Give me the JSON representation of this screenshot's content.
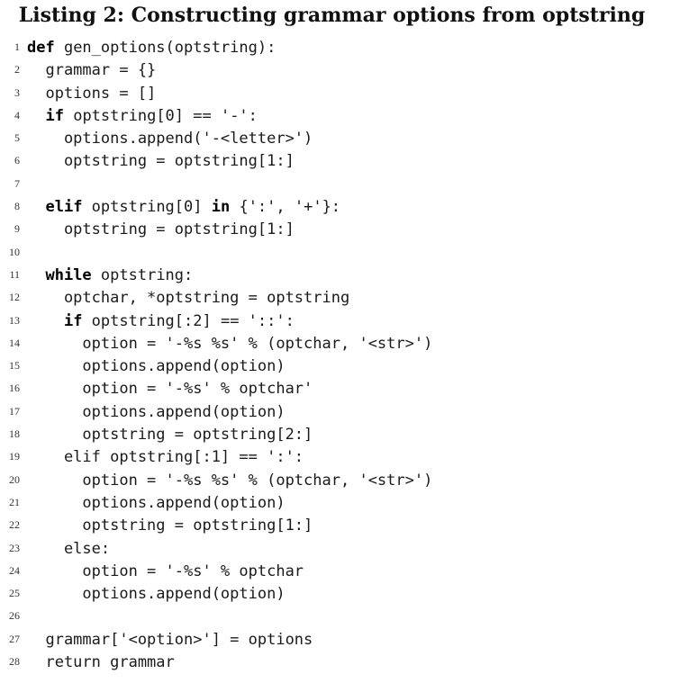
{
  "caption": "Listing 2: Constructing grammar options from optstring",
  "lines": [
    {
      "n": "1",
      "parts": [
        {
          "t": "def",
          "kw": true
        },
        {
          "t": " gen_options(optstring):"
        }
      ]
    },
    {
      "n": "2",
      "parts": [
        {
          "t": "  grammar = {}"
        }
      ]
    },
    {
      "n": "3",
      "parts": [
        {
          "t": "  options = []"
        }
      ]
    },
    {
      "n": "4",
      "parts": [
        {
          "t": "  "
        },
        {
          "t": "if",
          "kw": true
        },
        {
          "t": " optstring[0] == '-':"
        }
      ]
    },
    {
      "n": "5",
      "parts": [
        {
          "t": "    options.append('-<letter>')"
        }
      ]
    },
    {
      "n": "6",
      "parts": [
        {
          "t": "    optstring = optstring[1:]"
        }
      ]
    },
    {
      "n": "7",
      "parts": [
        {
          "t": ""
        }
      ]
    },
    {
      "n": "8",
      "parts": [
        {
          "t": "  "
        },
        {
          "t": "elif",
          "kw": true
        },
        {
          "t": " optstring[0] "
        },
        {
          "t": "in",
          "kw": true
        },
        {
          "t": " {':', '+'}:"
        }
      ]
    },
    {
      "n": "9",
      "parts": [
        {
          "t": "    optstring = optstring[1:]"
        }
      ]
    },
    {
      "n": "10",
      "parts": [
        {
          "t": ""
        }
      ]
    },
    {
      "n": "11",
      "parts": [
        {
          "t": "  "
        },
        {
          "t": "while",
          "kw": true
        },
        {
          "t": " optstring:"
        }
      ]
    },
    {
      "n": "12",
      "parts": [
        {
          "t": "    optchar, *optstring = optstring"
        }
      ]
    },
    {
      "n": "13",
      "parts": [
        {
          "t": "    "
        },
        {
          "t": "if",
          "kw": true
        },
        {
          "t": " optstring[:2] == '::':"
        }
      ]
    },
    {
      "n": "14",
      "parts": [
        {
          "t": "      option = '-%s %s' % (optchar, '<str>')"
        }
      ]
    },
    {
      "n": "15",
      "parts": [
        {
          "t": "      options.append(option)"
        }
      ]
    },
    {
      "n": "16",
      "parts": [
        {
          "t": "      option = '-%s' % optchar'"
        }
      ]
    },
    {
      "n": "17",
      "parts": [
        {
          "t": "      options.append(option)"
        }
      ]
    },
    {
      "n": "18",
      "parts": [
        {
          "t": "      optstring = optstring[2:]"
        }
      ]
    },
    {
      "n": "19",
      "parts": [
        {
          "t": "    elif optstring[:1] == ':':"
        }
      ]
    },
    {
      "n": "20",
      "parts": [
        {
          "t": "      option = '-%s %s' % (optchar, '<str>')"
        }
      ]
    },
    {
      "n": "21",
      "parts": [
        {
          "t": "      options.append(option)"
        }
      ]
    },
    {
      "n": "22",
      "parts": [
        {
          "t": "      optstring = optstring[1:]"
        }
      ]
    },
    {
      "n": "23",
      "parts": [
        {
          "t": "    else:"
        }
      ]
    },
    {
      "n": "24",
      "parts": [
        {
          "t": "      option = '-%s' % optchar"
        }
      ]
    },
    {
      "n": "25",
      "parts": [
        {
          "t": "      options.append(option)"
        }
      ]
    },
    {
      "n": "26",
      "parts": [
        {
          "t": ""
        }
      ]
    },
    {
      "n": "27",
      "parts": [
        {
          "t": "  grammar['<option>'] = options"
        }
      ]
    },
    {
      "n": "28",
      "parts": [
        {
          "t": "  return grammar"
        }
      ]
    }
  ]
}
